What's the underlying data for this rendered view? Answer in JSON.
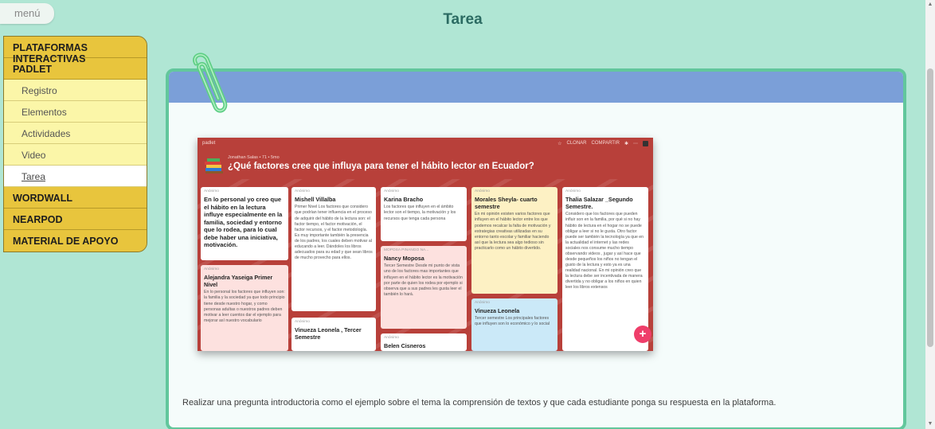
{
  "menu_label": "menú",
  "page_title": "Tarea",
  "nav": [
    {
      "label": "PLATAFORMAS INTERACTIVAS",
      "type": "head"
    },
    {
      "label": "PADLET",
      "type": "head"
    },
    {
      "label": "Registro",
      "type": "sub"
    },
    {
      "label": "Elementos",
      "type": "sub"
    },
    {
      "label": "Actividades",
      "type": "sub"
    },
    {
      "label": "Video",
      "type": "sub"
    },
    {
      "label": "Tarea",
      "type": "sub",
      "active": true
    },
    {
      "label": "WORDWALL",
      "type": "head"
    },
    {
      "label": "NEARPOD",
      "type": "head"
    },
    {
      "label": "MATERIAL DE APOYO",
      "type": "head"
    }
  ],
  "padlet": {
    "brand": "padlet",
    "actions": [
      "CLONAR",
      "COMPARTIR"
    ],
    "meta": "Jonathan Salas • 71 • 5mo",
    "title": "¿Qué factores cree que influya para tener el hábito lector en Ecuador?",
    "posts": [
      {
        "author": "Anónimo",
        "title": "En lo personal yo creo que el hábito en la lectura influye especialmente en la familia, sociedad y entorno que lo rodea, para lo cual debe haber una iniciativa, motivación.",
        "body": ""
      },
      {
        "author": "Anónimo",
        "title": "Alejandra Yaseiga Primer Nivel",
        "body": "En lo personal los factores que influyen son: la familia y la sociedad ya que todo principio tiene desde nuestro hogar, y como personas adultas o nuestros padres deben motivar a leer cuentos dar el ejemplo para mejorar así nuestro vocabulario"
      },
      {
        "author": "Anónimo",
        "title": "Mishell Villalba",
        "body": "Primer Nivel Los factores que considero que podrían tener influencia en el proceso de adquirir del hábito de la lectura son: el factor tiempo, el factor motivación, el factor recursos, y el factor metodología. Es muy importante también la presencia de los padres, los cuales deben motivar al educando a leer. Dándoles los libros adecuados para su edad y que sean libros de mucho provecho para ellos."
      },
      {
        "author": "Anónimo",
        "title": "Vinueza Leonela , Tercer Semestre",
        "body": ""
      },
      {
        "author": "Anónimo",
        "title": "Karina Bracho",
        "body": "Los factores que influyen en el ámbito lector son el tiempo, la motivación y los recursos que tenga cada persona"
      },
      {
        "author": "MOPOSA PINANGO NA...",
        "title": "Nancy Moposa",
        "body": "Tercer Semestre Desde mi punto de vista uno de los factores mas importantes que influyen en el hábito lector es la motivación por parte de quien los rodea por ejemplo si observa que a sus padres les gusta leer el también lo hará."
      },
      {
        "author": "Anónimo",
        "title": "Belen Cisneros",
        "body": ""
      },
      {
        "author": "Anónimo",
        "title": "Morales Sheyla- cuarto semestre",
        "body": "En mi opinión existen varios factores que influyen en el hábito lector entre los que podemos recalcar la falta de motivación y estrategias creativas utilizadas en su entorno tanto escolar y familiar haciendo así que la lectura sea algo tedioso sin practicarlo como un hábito divertido."
      },
      {
        "author": "Anónimo",
        "title": "Vinueza Leonela",
        "body": "Tercer semestre Los principales factores que influyen son lo económico y lo social"
      },
      {
        "author": "Anónimo",
        "title": "Thalia Salazar _Segundo Semestre.",
        "body": "Considero que los factores que pueden influir son en la familia, por qué si no hay hábito de lectura en el hogar no se puede obligar a leer si no le gusta. Otro factor puede ser también la tecnología ya que en la actualidad el internet y las redes sociales nos consume mucho tiempo observando videos , jugar y así hace que desde pequeños los niños no tengan el gusto de la lectura y esto ya es una realidad nacional. En mi opinión creo que la lectura debe ser incentivada de manera divertida y no obligar a los niños en quien leer los libros extensos"
      }
    ]
  },
  "description": "Realizar una pregunta introductoria como el ejemplo sobre el tema la comprensión de textos y que cada estudiante ponga su respuesta en la plataforma.",
  "colors": {
    "background": "#b0e6d4",
    "nav_head": "#e8c53d",
    "nav_sub": "#fbf6a8",
    "card_border": "#62c79c",
    "card_band": "#7b9fd8",
    "padlet_bg": "#b8403a",
    "fab": "#ef3e6a"
  }
}
